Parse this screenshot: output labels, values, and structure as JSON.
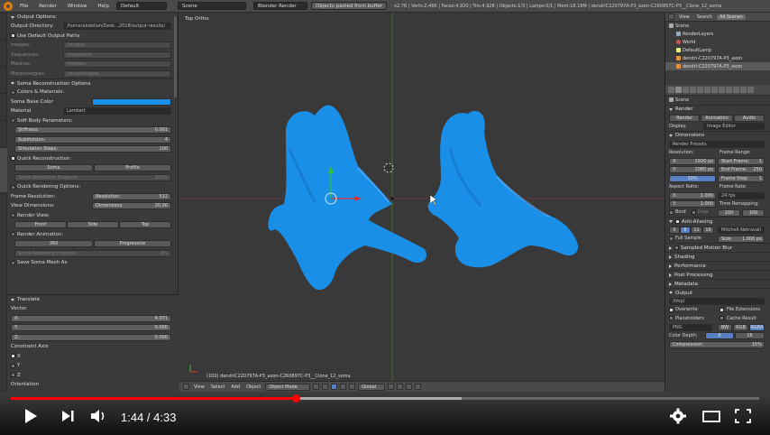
{
  "topbar": {
    "menus": [
      "File",
      "Render",
      "Window",
      "Help"
    ],
    "layout": "Default",
    "scene": "Scene",
    "engine": "Blender Render",
    "status": "Objects pasted from buffer",
    "info": "v2.76 | Verts:2,466 | Faces:4,920 | Tris:4,928 | Objects:1/3 | Lamps:0/1 | Mem:18.16M | dendriC220797A-P3_axon-C260897C-P3__Clone_12_soma"
  },
  "left_panel": {
    "output_options": "Output Options:",
    "output_directory_label": "Output Directory:",
    "output_directory_value": "/home/abdellah/Desk...2018/output-results/",
    "use_default_paths": "Use Default Output Paths",
    "images_label": "Images:",
    "images_value": "/images",
    "sequences_label": "Sequences:",
    "sequences_value": "/sequences",
    "meshes_label": "Meshes:",
    "meshes_value": "/meshes",
    "morphologies_label": "Morphologies:",
    "morphologies_value": "/morphologies",
    "soma_reconstruction_options": "Soma Reconstruction Options",
    "colors_materials": "Colors & Materials:",
    "soma_base_color": "Soma Base Color",
    "material_label": "Material",
    "material_value": "Lambert",
    "soft_body_parameters": "Soft Body Parameters:",
    "stiffness_label": "Stiffness:",
    "stiffness_value": "0.001",
    "subdivision_label": "Subdivision:",
    "subdivision_value": "4",
    "simulation_steps_label": "Simulation Steps:",
    "simulation_steps_value": "100",
    "quick_reconstruction": "Quick Reconstruction:",
    "soma_button": "Soma",
    "profile_button": "Profile",
    "soma_progress_label": "Soma Simulation Progress",
    "soma_progress_value": "100%",
    "quick_rendering_options": "Quick Rendering Options:",
    "frame_resolution_label": "Frame Resolution:",
    "resolution_label": "Resolution:",
    "resolution_value": "512",
    "view_dimensions_label": "View Dimensions:",
    "dimensions_label": "Dimensions:",
    "dimensions_value": "20.00",
    "render_view": "Render View:",
    "front_button": "Front",
    "side_button": "Side",
    "top_button": "Top",
    "render_animation": "Render Animation:",
    "btn_360": "360",
    "progressive_button": "Progressive",
    "soma_rendering_progress_label": "Soma Rendering Progress",
    "soma_rendering_progress_value": "0%",
    "save_soma_mesh_as": "Save Soma Mesh As"
  },
  "translate_panel": {
    "title": "Translate",
    "vector": "Vector",
    "x_label": "X:",
    "x_value": "4.071",
    "y_label": "Y:",
    "y_value": "0.000",
    "z_label": "Z:",
    "z_value": "0.000",
    "constraint_axis": "Constraint Axis",
    "cx": "X",
    "cy": "Y",
    "cz": "Z",
    "orientation": "Orientation"
  },
  "viewport": {
    "view_label": "Top Ortho",
    "object_label": "(100) dendriC220797A-P3_axon-C260897C-P3__Clone_12_soma",
    "header": {
      "view": "View",
      "select": "Select",
      "add": "Add",
      "object": "Object",
      "mode": "Object Mode",
      "global": "Global"
    }
  },
  "outliner": {
    "tabs": [
      "View",
      "Search",
      "All Scenes"
    ],
    "items": [
      "Scene",
      "RenderLayers",
      "World",
      "DefaultLamp",
      "dendri-C220797A-P3_axon",
      "dendri-C220797A-P3_axon"
    ]
  },
  "properties": {
    "scene": "Scene",
    "render": "Render",
    "render_button": "Render",
    "animation_button": "Animation",
    "audio_button": "Audio",
    "display_label": "Display:",
    "display_value": "Image Editor",
    "dimensions": "Dimensions",
    "render_presets": "Render Presets",
    "resolution": "Resolution:",
    "res_x": "X:",
    "res_x_value": "1920 px",
    "res_y": "Y:",
    "res_y_value": "1080 px",
    "res_pct": "50%",
    "frame_range": "Frame Range:",
    "start_frame": "Start Frame:",
    "start_frame_value": "1",
    "end_frame": "End Frame:",
    "end_frame_value": "250",
    "frame_step": "Frame Step:",
    "frame_step_value": "1",
    "aspect_ratio": "Aspect Ratio:",
    "asp_x": "X:",
    "asp_x_value": "1.000",
    "asp_y": "Y:",
    "asp_y_value": "1.000",
    "frame_rate": "Frame Rate:",
    "fps": "24 fps",
    "time_remapping": "Time Remapping:",
    "remap_old": "100",
    "remap_new": "100",
    "border": "Bord",
    "crop": "Crop",
    "anti_aliasing": "Anti-Aliasing",
    "aa_5": "5",
    "aa_8": "8",
    "aa_11": "11",
    "aa_16": "16",
    "filter": "Mitchell-Netravali",
    "full_sample": "Full Sample",
    "size_label": "Size:",
    "size_value": "1.000 px",
    "sampled_motion_blur": "Sampled Motion Blur",
    "shading": "Shading",
    "performance": "Performance",
    "post_processing": "Post Processing",
    "metadata": "Metadata",
    "output": "Output",
    "output_path": "/tmp/",
    "overwrite": "Overwrite",
    "file_extensions": "File Extensions",
    "placeholders": "Placeholders",
    "cache_result": "Cache Result",
    "format": "PNG",
    "bw": "BW",
    "rgb": "RGB",
    "rgba": "RGBA",
    "color_depth": "Color Depth:",
    "depth_8": "8",
    "depth_16": "16",
    "compression": "Compression:",
    "compression_value": "15%"
  },
  "player": {
    "time": "1:44 / 4:33",
    "progress": 0.381
  },
  "colors": {
    "soma_blue": "#1a8fe8",
    "youtube_red": "#ff0000"
  }
}
